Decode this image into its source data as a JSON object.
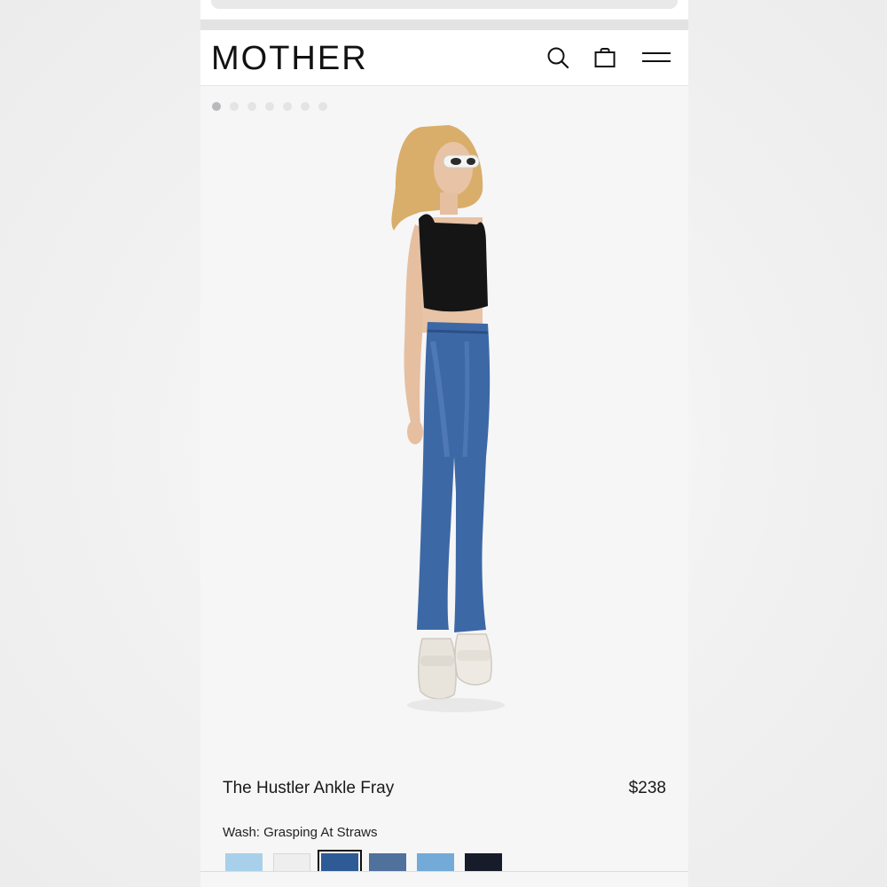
{
  "header": {
    "logo": "MOTHER",
    "icons": [
      "search-icon",
      "shopping-bag-icon",
      "menu-icon"
    ]
  },
  "gallery": {
    "dot_count": 7,
    "active_index": 0
  },
  "product": {
    "title": "The Hustler Ankle Fray",
    "price": "$238",
    "wash_label": "Wash: Grasping At Straws",
    "swatches": [
      {
        "color": "#a9d0ea",
        "selected": false
      },
      {
        "color": "#eeeeee",
        "selected": false
      },
      {
        "color": "#2e5a96",
        "selected": true
      },
      {
        "color": "#50719c",
        "selected": false
      },
      {
        "color": "#74aad8",
        "selected": false
      },
      {
        "color": "#171c2b",
        "selected": false
      }
    ]
  },
  "colors": {
    "page_bg": "#f6f6f7",
    "header_bg": "#ffffff",
    "text": "#1a1a1a"
  }
}
